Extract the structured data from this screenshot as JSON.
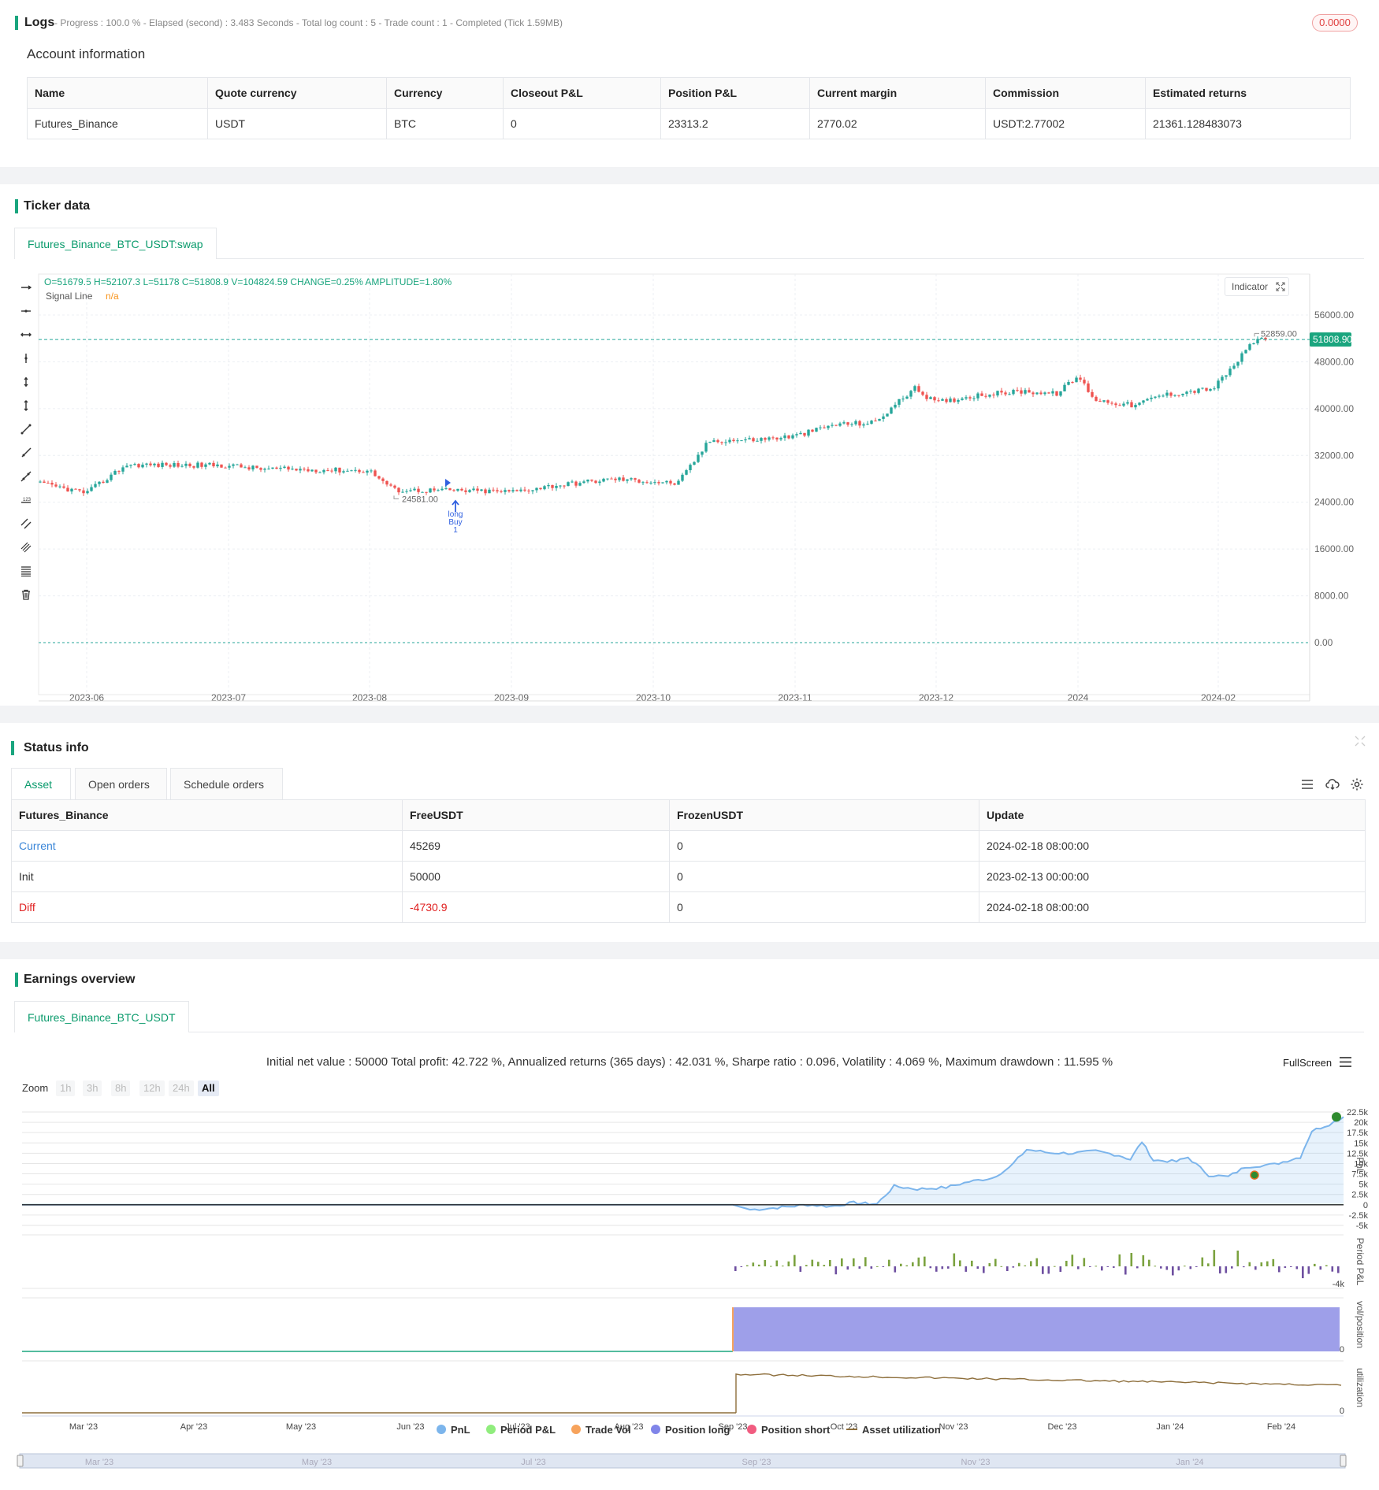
{
  "logs": {
    "title": "Logs",
    "status": "- Progress : 100.0 % - Elapsed (second) : 3.483 Seconds - Total log count : 5 - Trade count : 1 - Completed (Tick 1.59MB)",
    "badge": "0.0000"
  },
  "account": {
    "title": "Account information",
    "columns": [
      "Name",
      "Quote currency",
      "Currency",
      "Closeout P&L",
      "Position P&L",
      "Current margin",
      "Commission",
      "Estimated returns"
    ],
    "row": [
      "Futures_Binance",
      "USDT",
      "BTC",
      "0",
      "23313.2",
      "2770.02",
      "USDT:2.77002",
      "21361.128483073"
    ]
  },
  "ticker": {
    "title": "Ticker data",
    "tab": "Futures_Binance_BTC_USDT:swap",
    "ohlc_text": "O=51679.5 H=52107.3 L=51178 C=51808.9 V=104824.59 CHANGE=0.25% AMPLITUDE=1.80%",
    "signal_label": "Signal Line",
    "signal_value": "n/a",
    "indicator_btn": "Indicator",
    "last_price": "51808.90",
    "high_label": "52859.00",
    "low_label": "24581.00",
    "trade_marker": [
      "long",
      "Buy",
      "1"
    ],
    "y_ticks": [
      "56000.00",
      "48000.00",
      "40000.00",
      "32000.00",
      "24000.00",
      "16000.00",
      "8000.00",
      "0.00"
    ],
    "x_ticks": [
      "2023-06",
      "2023-07",
      "2023-08",
      "2023-09",
      "2023-10",
      "2023-11",
      "2023-12",
      "2024",
      "2024-02"
    ]
  },
  "status": {
    "title": "Status info",
    "tabs": [
      "Asset",
      "Open orders",
      "Schedule orders"
    ],
    "columns": [
      "Futures_Binance",
      "FreeUSDT",
      "FrozenUSDT",
      "Update"
    ],
    "rows": [
      [
        "Current",
        "45269",
        "0",
        "2024-02-18 08:00:00"
      ],
      [
        "Init",
        "50000",
        "0",
        "2023-02-13 00:00:00"
      ],
      [
        "Diff",
        "-4730.9",
        "0",
        "2024-02-18 08:00:00"
      ]
    ]
  },
  "earnings": {
    "title": "Earnings overview",
    "tab": "Futures_Binance_BTC_USDT",
    "summary": "Initial net value : 50000 Total profit: 42.722 %, Annualized returns (365 days) : 42.031 %, Sharpe ratio : 0.096, Volatility : 4.069 %, Maximum drawdown : 11.595 %",
    "fullscreen": "FullScreen",
    "zoom_label": "Zoom",
    "zoom_options": [
      "1h",
      "3h",
      "8h",
      "12h",
      "24h",
      "All"
    ],
    "pnl_ticks": [
      "22.5k",
      "20k",
      "17.5k",
      "15k",
      "12.5k",
      "10k",
      "7.5k",
      "5k",
      "2.5k",
      "0",
      "-2.5k",
      "-5k"
    ],
    "axis_titles": [
      "PnL",
      "Period P&L",
      "vol/position",
      "utilization"
    ],
    "period_tick": "-4k",
    "zero_label": "0",
    "x_ticks": [
      "Mar '23",
      "Apr '23",
      "May '23",
      "Jun '23",
      "Jul '23",
      "Aug '23",
      "Sep '23",
      "Oct '23",
      "Nov '23",
      "Dec '23",
      "Jan '24",
      "Feb '24"
    ],
    "nav_ticks": [
      "Mar '23",
      "May '23",
      "Jul '23",
      "Sep '23",
      "Nov '23",
      "Jan '24"
    ],
    "legend": [
      {
        "label": "PnL",
        "color": "#7cb5ec"
      },
      {
        "label": "Period P&L",
        "color": "#90ed7d"
      },
      {
        "label": "Trade Vol",
        "color": "#f7a35c"
      },
      {
        "label": "Position long",
        "color": "#8085e9"
      },
      {
        "label": "Position short",
        "color": "#f15c80"
      },
      {
        "label": "Asset utilization",
        "color": "#8d6e3b"
      }
    ]
  },
  "colors": {
    "accent": "#1aa57e",
    "up": "#26a69a",
    "down": "#ef5350",
    "diff": "#e02020",
    "link": "#3a86d8"
  }
}
